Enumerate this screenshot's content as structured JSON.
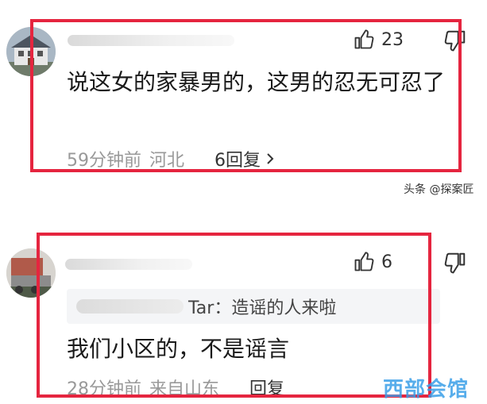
{
  "comments": [
    {
      "like_count": "23",
      "text": "说这女的家暴男的，这男的忍无可忍了",
      "time": "59分钟前",
      "location": "河北",
      "reply_label": "6回复"
    },
    {
      "like_count": "6",
      "quote_author": "Tar：",
      "quote_text": "造谣的人来啦",
      "text": "我们小区的，不是谣言",
      "time": "28分钟前",
      "location": "来自山东",
      "reply_label": "回复"
    }
  ],
  "source_tag": "头条 @探案匠",
  "watermark": "西部会馆",
  "colors": {
    "highlight": "#e5253f",
    "watermark": "#3a9fe8",
    "meta_text": "#999999"
  },
  "icons": [
    "thumbs-up-icon",
    "thumbs-down-icon",
    "chevron-right-icon"
  ]
}
